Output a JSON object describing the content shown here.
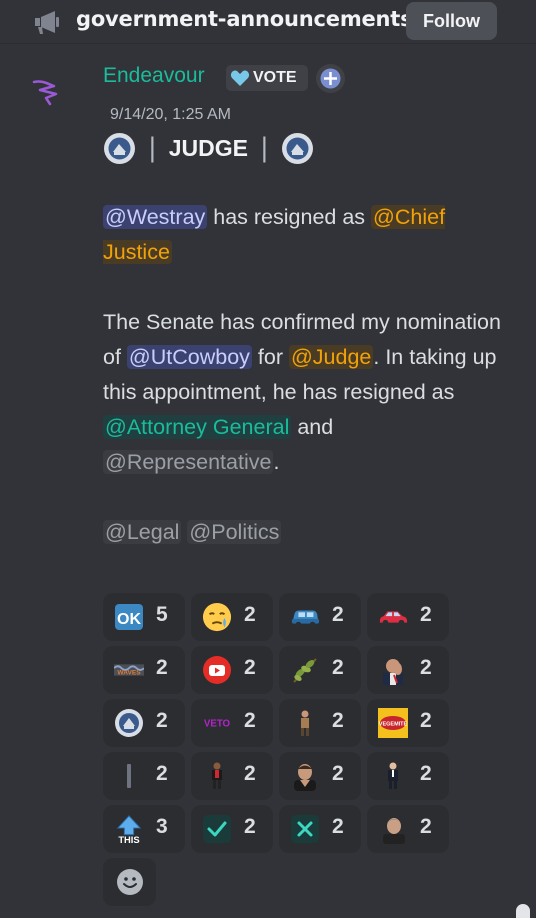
{
  "header": {
    "channel_name": "government-announcements",
    "follow_label": "Follow",
    "channel_icon": "megaphone-icon"
  },
  "message": {
    "author": "Endeavour",
    "role_tag": "VOTE",
    "timestamp": "9/14/20, 1:25 AM",
    "title": "JUDGE",
    "title_separator": "|",
    "colors": {
      "author": "#1abc9c",
      "mention_user_bg": "#3c4270",
      "mention_orange": "#f1a20a",
      "mention_teal": "#1abc9c",
      "mention_grey": "#9ca0a6"
    },
    "para1": {
      "mention1": "@Westray",
      "text1": " has resigned as ",
      "mention2": "@Chief Justice"
    },
    "para2": {
      "text1": "The Senate has confirmed my nomination of ",
      "mention1": "@UtCowboy",
      "text2": " for ",
      "mention2": "@Judge",
      "text3": ". In taking up this appointment, he has resigned as ",
      "mention3": "@Attorney General",
      "text4": " and ",
      "mention4": "@Representative",
      "text5": "."
    },
    "para3": {
      "mention1": "@Legal",
      "mention2": "@Politics"
    }
  },
  "reactions": [
    {
      "emoji": "ok-button-icon",
      "count": "5"
    },
    {
      "emoji": "sad-relieved-face-icon",
      "count": "2"
    },
    {
      "emoji": "blue-car-icon",
      "count": "2"
    },
    {
      "emoji": "red-car-icon",
      "count": "2"
    },
    {
      "emoji": "waves-text-icon",
      "count": "2",
      "label": "WAVES"
    },
    {
      "emoji": "youtube-icon",
      "count": "2"
    },
    {
      "emoji": "leaf-branch-icon",
      "count": "2"
    },
    {
      "emoji": "face-palm-person-icon",
      "count": "2"
    },
    {
      "emoji": "government-seal-icon",
      "count": "2"
    },
    {
      "emoji": "veto-text-icon",
      "count": "2",
      "label": "VETO"
    },
    {
      "emoji": "standing-figure-icon",
      "count": "2"
    },
    {
      "emoji": "vegemite-icon",
      "count": "2",
      "label": "VEGEMITE"
    },
    {
      "emoji": "thin-bar-icon",
      "count": "2"
    },
    {
      "emoji": "small-person-red-icon",
      "count": "2"
    },
    {
      "emoji": "man-portrait-icon",
      "count": "2"
    },
    {
      "emoji": "suit-person-icon",
      "count": "2"
    },
    {
      "emoji": "this-arrow-icon",
      "count": "3",
      "label": "THIS"
    },
    {
      "emoji": "check-mark-icon",
      "count": "2"
    },
    {
      "emoji": "cross-mark-icon",
      "count": "2"
    },
    {
      "emoji": "man-face-icon",
      "count": "2"
    }
  ]
}
